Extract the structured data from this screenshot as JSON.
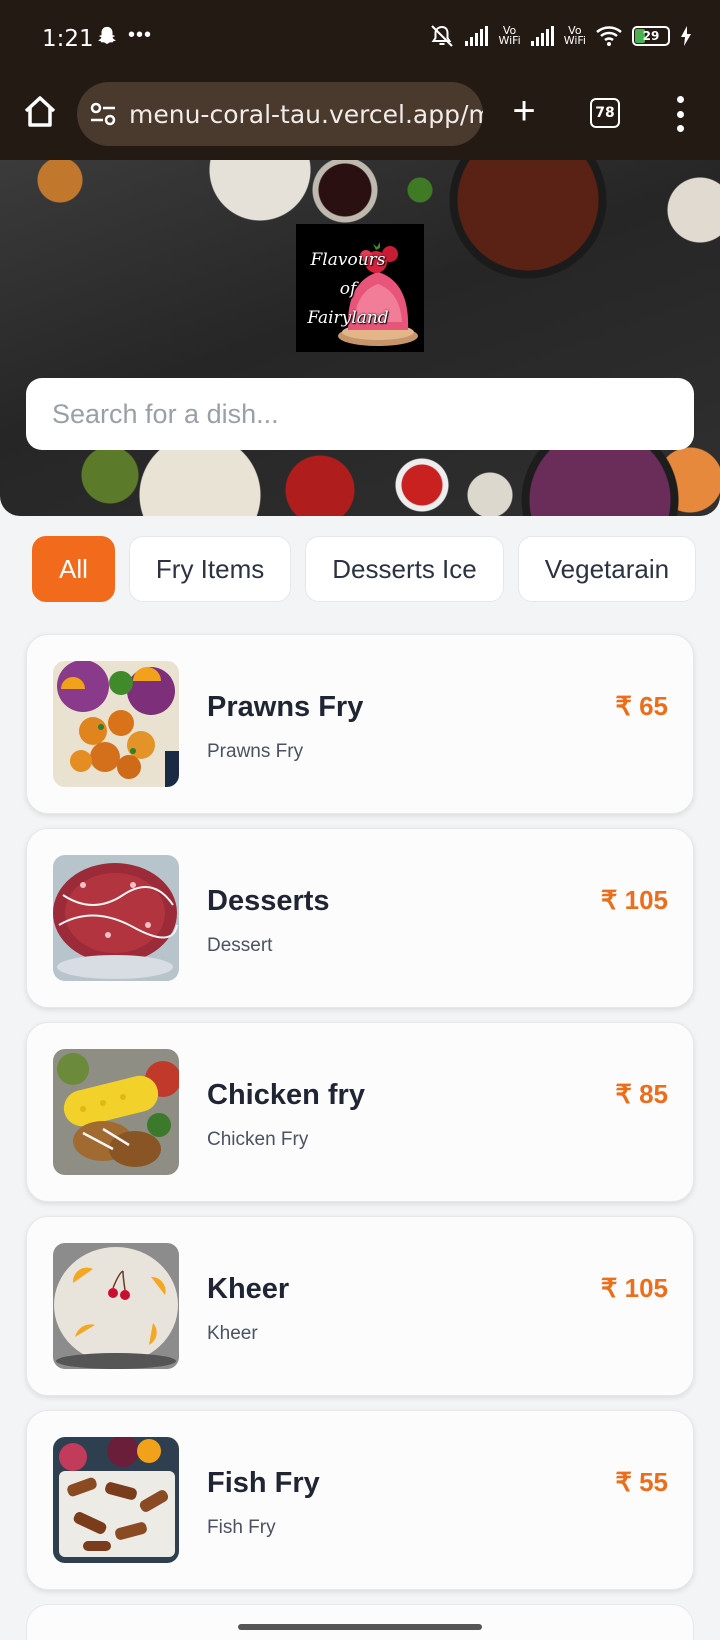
{
  "status_bar": {
    "time": "1:21",
    "vowifi_1": "Vo\nWiFi",
    "vowifi_2": "Vo\nWiFi",
    "battery_level": "29"
  },
  "browser": {
    "url": "menu-coral-tau.vercel.app/m",
    "tab_count": "78"
  },
  "hero": {
    "logo_text": [
      "Flavours",
      "of",
      "Fairyland"
    ],
    "search_placeholder": "Search for a dish..."
  },
  "categories": [
    {
      "label": "All",
      "active": true
    },
    {
      "label": "Fry Items",
      "active": false
    },
    {
      "label": "Desserts Ice",
      "active": false
    },
    {
      "label": "Vegetarain",
      "active": false
    }
  ],
  "menu_items": [
    {
      "name": "Prawns Fry",
      "description": "Prawns Fry",
      "price": "₹ 65",
      "image": "prawns-fry-photo"
    },
    {
      "name": "Desserts",
      "description": "Dessert",
      "price": "₹ 105",
      "image": "dessert-photo"
    },
    {
      "name": "Chicken fry",
      "description": "Chicken Fry",
      "price": "₹ 85",
      "image": "chicken-fry-photo"
    },
    {
      "name": "Kheer",
      "description": "Kheer",
      "price": "₹ 105",
      "image": "kheer-photo"
    },
    {
      "name": "Fish Fry",
      "description": "Fish Fry",
      "price": "₹ 55",
      "image": "fish-fry-photo"
    }
  ],
  "colors": {
    "accent": "#f26b1d",
    "price": "#ea6e1c",
    "browser_bar": "#241a14"
  }
}
